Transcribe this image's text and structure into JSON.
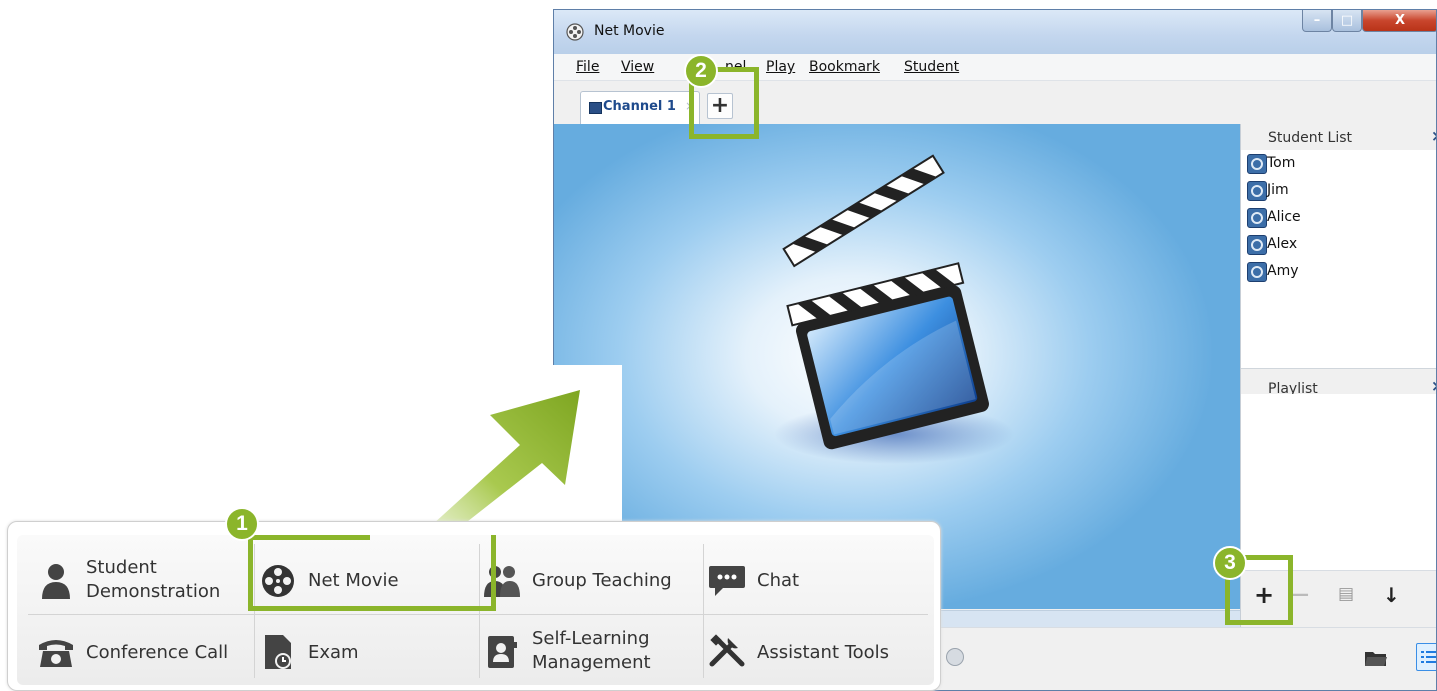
{
  "window": {
    "title": "Net Movie",
    "menu": [
      "File",
      "View",
      "Channel",
      "Play",
      "Bookmark",
      "Student"
    ],
    "menu_visible": [
      "File",
      "View",
      "nel",
      "Play",
      "Bookmark",
      "Student"
    ],
    "tab_label": "Channel 1",
    "tab_close": "×",
    "tab_add": "+",
    "minimize": "–",
    "maximize": "□",
    "close": "X"
  },
  "student_list": {
    "title": "Student List",
    "close": "×",
    "students": [
      "Tom",
      "Jim",
      "Alice",
      "Alex",
      "Amy"
    ]
  },
  "playlist": {
    "title": "Playlist",
    "close": "×",
    "tools": {
      "add": "+",
      "remove": "—",
      "edit": "▤",
      "down": "↓"
    }
  },
  "badges": [
    "1",
    "2",
    "3"
  ],
  "toolbar": {
    "items": [
      {
        "label": "Student\nDemonstration",
        "icon": "person-icon"
      },
      {
        "label": "Net Movie",
        "icon": "film-reel-icon"
      },
      {
        "label": "Group Teaching",
        "icon": "group-icon"
      },
      {
        "label": "Chat",
        "icon": "chat-icon"
      },
      {
        "label": "Conference Call",
        "icon": "telephone-icon"
      },
      {
        "label": "Exam",
        "icon": "exam-icon"
      },
      {
        "label": "Self-Learning\nManagement",
        "icon": "self-learning-icon"
      },
      {
        "label": "Assistant Tools",
        "icon": "tools-icon"
      }
    ]
  },
  "colors": {
    "accent_green": "#8bb52b",
    "window_border": "#5f7fa8",
    "video_blue": "#66acdf"
  }
}
